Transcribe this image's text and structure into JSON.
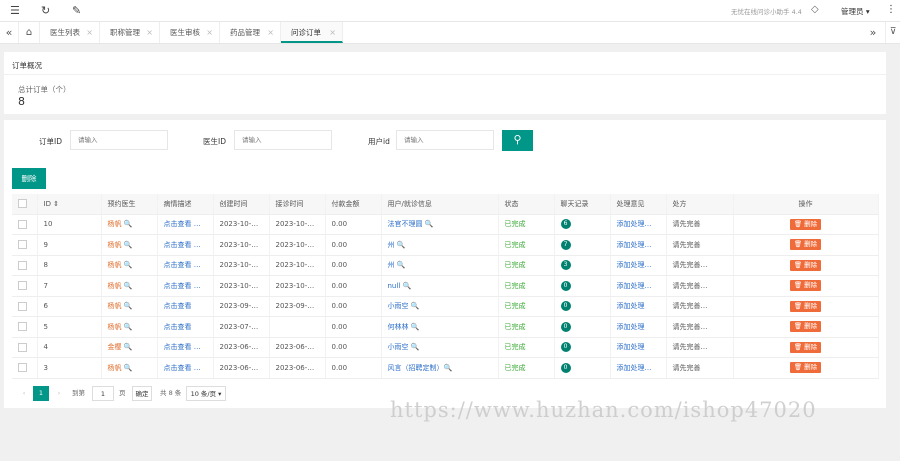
{
  "topbar": {
    "menu_icon": "☰",
    "refresh_icon": "↻",
    "clear_icon": "✎",
    "brand_text": "无忧在线问诊小助手 4.4",
    "tag_icon": "◇",
    "user_label": "管理员 ▾",
    "more_icon": "⋮"
  },
  "tabs": {
    "prev_icon": "«",
    "next_icon": "»",
    "home_icon": "⌂",
    "close_icon": "×",
    "menu_icon": "⊽",
    "items": [
      {
        "label": "医生列表"
      },
      {
        "label": "职称管理"
      },
      {
        "label": "医生审核"
      },
      {
        "label": "药品管理"
      },
      {
        "label": "问诊订单"
      }
    ]
  },
  "overview": {
    "title": "订单概况",
    "stat_label": "总计订单（个）",
    "stat_value": "8"
  },
  "filters": {
    "order_id_label": "订单ID",
    "doctor_id_label": "医生ID",
    "user_id_label": "用户id",
    "placeholder": "请输入",
    "search_icon": "⚲"
  },
  "delete_label": "删除",
  "table": {
    "headers": [
      "",
      "ID ⇕",
      "预约医生",
      "病情描述",
      "创建时间",
      "接诊时间",
      "付款金额",
      "用户/就诊信息",
      "状态",
      "聊天记录",
      "处理意见",
      "处方",
      "操作"
    ],
    "rows": [
      {
        "id": "10",
        "doctor": "杨帆 🔍",
        "desc": "点击查看 …",
        "created": "2023-10-…",
        "accepted": "2023-10-…",
        "amount": "0.00",
        "user": "法官不理圆 🔍",
        "status": "已完成",
        "chat": "6",
        "opinion": "添加处理…",
        "rx": "请先完善",
        "op": "🗑 删除"
      },
      {
        "id": "9",
        "doctor": "杨帆 🔍",
        "desc": "点击查看 …",
        "created": "2023-10-…",
        "accepted": "2023-10-…",
        "amount": "0.00",
        "user": "州 🔍",
        "status": "已完成",
        "chat": "7",
        "opinion": "添加处理…",
        "rx": "请先完善",
        "op": "🗑 删除"
      },
      {
        "id": "8",
        "doctor": "杨帆 🔍",
        "desc": "点击查看 …",
        "created": "2023-10-…",
        "accepted": "2023-10-…",
        "amount": "0.00",
        "user": "州 🔍",
        "status": "已完成",
        "chat": "3",
        "opinion": "添加处理…",
        "rx": "请先完善…",
        "op": "🗑 删除"
      },
      {
        "id": "7",
        "doctor": "杨帆 🔍",
        "desc": "点击查看 …",
        "created": "2023-10-…",
        "accepted": "2023-10-…",
        "amount": "0.00",
        "user": "null 🔍",
        "status": "已完成",
        "chat": "0",
        "opinion": "添加处理…",
        "rx": "请先完善…",
        "op": "🗑 删除"
      },
      {
        "id": "6",
        "doctor": "杨帆 🔍",
        "desc": "点击查看",
        "created": "2023-09-…",
        "accepted": "2023-09-…",
        "amount": "0.00",
        "user": "小雨空 🔍",
        "status": "已完成",
        "chat": "0",
        "opinion": "添加处理",
        "rx": "请先完善…",
        "op": "🗑 删除"
      },
      {
        "id": "5",
        "doctor": "杨帆 🔍",
        "desc": "点击查看",
        "created": "2023-07-…",
        "accepted": "",
        "amount": "0.00",
        "user": "何林林 🔍",
        "status": "已完成",
        "chat": "0",
        "opinion": "添加处理",
        "rx": "请先完善…",
        "op": "🗑 删除"
      },
      {
        "id": "4",
        "doctor": "金樱 🔍",
        "desc": "点击查看 …",
        "created": "2023-06-…",
        "accepted": "2023-06-…",
        "amount": "0.00",
        "user": "小雨空 🔍",
        "status": "已完成",
        "chat": "0",
        "opinion": "添加处理",
        "rx": "请先完善…",
        "op": "🗑 删除"
      },
      {
        "id": "3",
        "doctor": "杨帆 🔍",
        "desc": "点击查看 …",
        "created": "2023-06-…",
        "accepted": "2023-06-…",
        "amount": "0.00",
        "user": "风言（招聘定制）🔍",
        "status": "已完成",
        "chat": "0",
        "opinion": "添加处理…",
        "rx": "请先完善",
        "op": "🗑 删除"
      }
    ]
  },
  "pager": {
    "prev": "‹",
    "current": "1",
    "next": "›",
    "goto_label": "到第",
    "page_value": "1",
    "page_unit": "页",
    "confirm": "确定",
    "total": "共 8 条",
    "page_size": "10 条/页 ▾"
  },
  "watermark": "https://www.huzhan.com/ishop47020"
}
